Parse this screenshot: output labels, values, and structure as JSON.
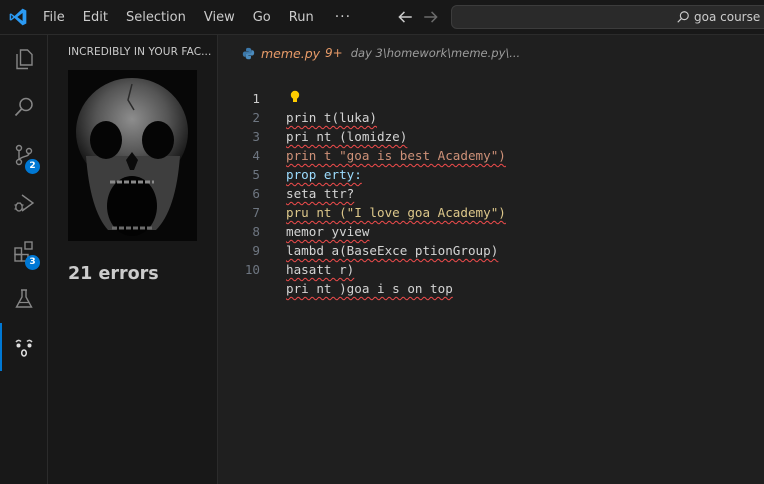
{
  "titlebar": {
    "menu": [
      "File",
      "Edit",
      "Selection",
      "View",
      "Go",
      "Run",
      "···"
    ],
    "search_text": "goa course"
  },
  "activitybar": {
    "items": [
      {
        "name": "explorer-icon"
      },
      {
        "name": "search-icon"
      },
      {
        "name": "source-control-icon",
        "badge": "2"
      },
      {
        "name": "run-debug-icon"
      },
      {
        "name": "extensions-icon",
        "badge": "3"
      },
      {
        "name": "testing-flask-icon"
      },
      {
        "name": "surprised-face-icon"
      }
    ]
  },
  "sidepanel": {
    "title": "INCREDIBLY IN YOUR FAC...",
    "error_count": "21 errors"
  },
  "editor": {
    "breadcrumb": {
      "file": "meme.py",
      "problems": "9+",
      "path": "day 3\\homework\\meme.py\\..."
    },
    "lines": [
      {
        "n": "1",
        "text": "prin t(luka)"
      },
      {
        "n": "2",
        "text": "pri nt (lomidze)"
      },
      {
        "n": "3",
        "text": "prin t \"goa is best Academy\")"
      },
      {
        "n": "4",
        "text": "prop erty:"
      },
      {
        "n": "5",
        "text": "seta ttr?"
      },
      {
        "n": "6",
        "text": "pru nt (\"I love goa Academy\")"
      },
      {
        "n": "7",
        "text": "memor yview"
      },
      {
        "n": "8",
        "text": "lambd a(BaseExce ptionGroup)"
      },
      {
        "n": "9",
        "text": "hasatt r)"
      },
      {
        "n": "10",
        "text": "pri nt )goa i s on top"
      }
    ]
  },
  "colors": {
    "accent": "#0078d4",
    "error_squiggle": "#f14c4c",
    "file_modified": "#e89b68",
    "string": "#ce9178",
    "bracket": "#ffd700",
    "keyword_blue": "#9cdcfe"
  }
}
